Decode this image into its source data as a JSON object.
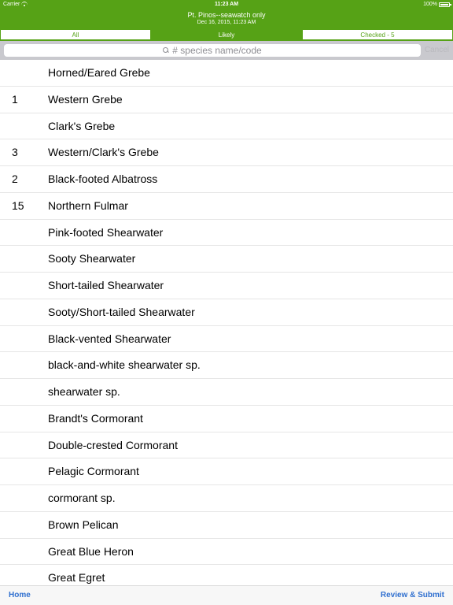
{
  "status_bar": {
    "carrier": "Carrier",
    "time": "11:23 AM",
    "battery": "100%"
  },
  "header": {
    "title": "Pt. Pinos--seawatch only",
    "subtitle": "Dec 16, 2015, 11:23 AM"
  },
  "tabs": [
    {
      "label": "All",
      "active": false
    },
    {
      "label": "Likely",
      "active": true
    },
    {
      "label": "Checked - 5",
      "active": false
    }
  ],
  "search": {
    "placeholder": "# species name/code",
    "cancel_label": "Cancel"
  },
  "species": [
    {
      "count": "",
      "name": "Horned/Eared Grebe"
    },
    {
      "count": "1",
      "name": "Western Grebe"
    },
    {
      "count": "",
      "name": "Clark's Grebe"
    },
    {
      "count": "3",
      "name": "Western/Clark's Grebe"
    },
    {
      "count": "2",
      "name": "Black-footed Albatross"
    },
    {
      "count": "15",
      "name": "Northern Fulmar"
    },
    {
      "count": "",
      "name": "Pink-footed Shearwater"
    },
    {
      "count": "",
      "name": "Sooty Shearwater"
    },
    {
      "count": "",
      "name": "Short-tailed Shearwater"
    },
    {
      "count": "",
      "name": "Sooty/Short-tailed Shearwater"
    },
    {
      "count": "",
      "name": "Black-vented Shearwater"
    },
    {
      "count": "",
      "name": "black-and-white shearwater sp."
    },
    {
      "count": "",
      "name": "shearwater sp."
    },
    {
      "count": "",
      "name": "Brandt's Cormorant"
    },
    {
      "count": "",
      "name": "Double-crested Cormorant"
    },
    {
      "count": "",
      "name": "Pelagic Cormorant"
    },
    {
      "count": "",
      "name": "cormorant sp."
    },
    {
      "count": "",
      "name": "Brown Pelican"
    },
    {
      "count": "",
      "name": "Great Blue Heron"
    },
    {
      "count": "",
      "name": "Great Egret"
    }
  ],
  "toolbar": {
    "home_label": "Home",
    "submit_label": "Review & Submit"
  },
  "colors": {
    "accent": "#56a216",
    "link": "#2f6fcf"
  }
}
